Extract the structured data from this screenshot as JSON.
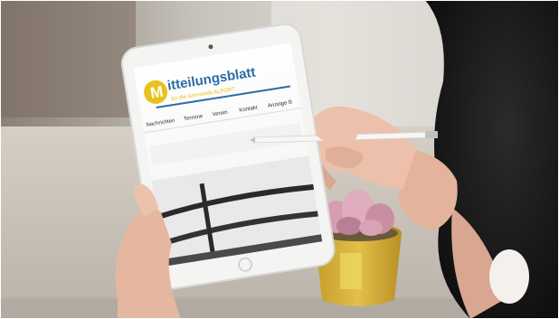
{
  "photo": {
    "tablet_screen": {
      "logo_letter": "M",
      "logo_title": "itteilungsblatt",
      "logo_subtitle": "für die Gemeinde ALPORT",
      "nav_items": [
        "Nachrichten",
        "Termine",
        "Verein",
        "Kontakt"
      ],
      "nav_trailing": "Anzeige B"
    },
    "colors": {
      "logo_yellow": "#e8c21c",
      "logo_blue": "#2b6ca8",
      "desk": "#d9d2c8",
      "wall": "#b4b0aa",
      "hair": "#1c1c1c",
      "skin": "#e8b9a2",
      "pot_yellow": "#d9b43a",
      "succulent": "#d59db0"
    }
  }
}
